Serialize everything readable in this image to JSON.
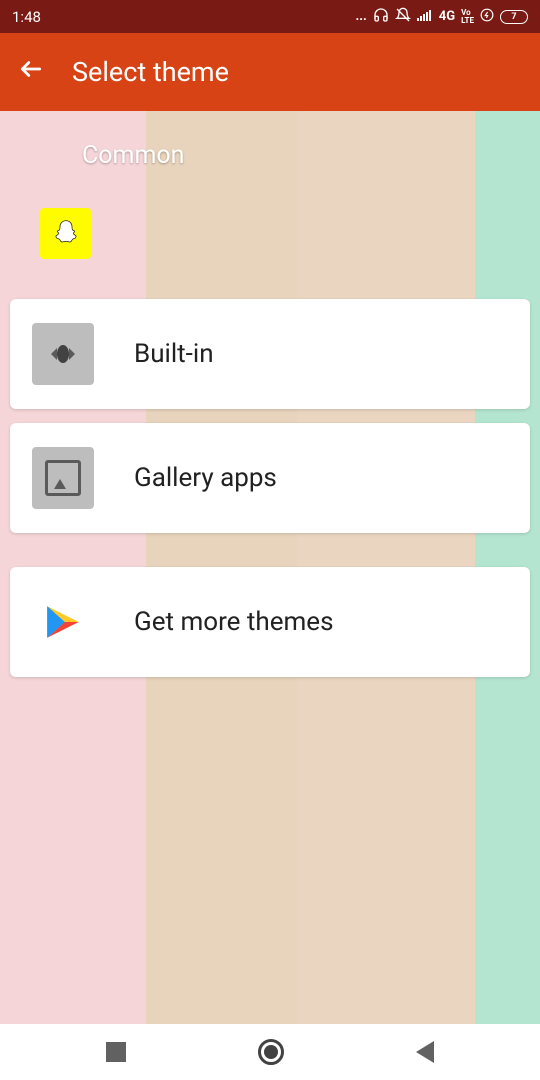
{
  "statusBar": {
    "time": "1:48",
    "ellipsis": "...",
    "network": "4G",
    "lte": "LTE",
    "vo": "Vo",
    "battery": "7"
  },
  "appBar": {
    "title": "Select theme"
  },
  "section": {
    "label": "Common"
  },
  "options": [
    {
      "label": "Built-in"
    },
    {
      "label": "Gallery apps"
    },
    {
      "label": "Get more themes"
    }
  ]
}
